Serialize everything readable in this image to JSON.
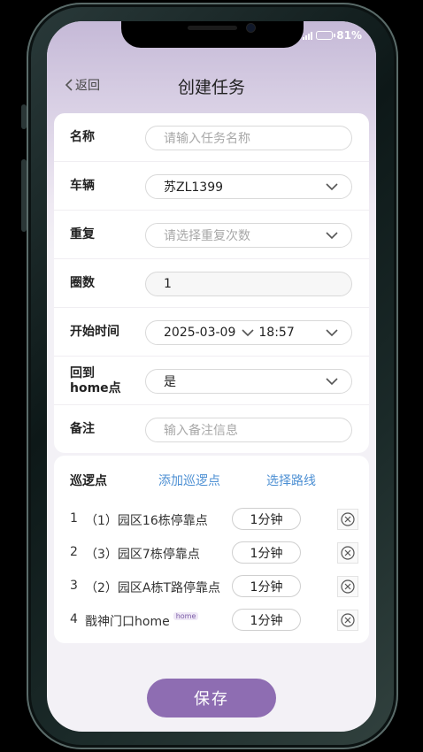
{
  "status_bar": {
    "battery": "81%"
  },
  "nav": {
    "back_label": "返回",
    "title": "创建任务"
  },
  "form": {
    "name": {
      "label": "名称",
      "placeholder": "请输入任务名称"
    },
    "vehicle": {
      "label": "车辆",
      "value": "苏ZL1399"
    },
    "repeat": {
      "label": "重复",
      "placeholder": "请选择重复次数"
    },
    "laps": {
      "label": "圈数",
      "value": "1"
    },
    "start_time": {
      "label": "开始时间",
      "date": "2025-03-09",
      "time": "18:57"
    },
    "return_home": {
      "label_line1": "回到",
      "label_line2": "home点",
      "value": "是"
    },
    "remark": {
      "label": "备注",
      "placeholder": "输入备注信息"
    }
  },
  "patrol": {
    "title": "巡逻点",
    "add_label": "添加巡逻点",
    "route_label": "选择路线",
    "items": [
      {
        "index": "1",
        "name": "（1）园区16栋停靠点",
        "duration": "1分钟"
      },
      {
        "index": "2",
        "name": "（3）园区7栋停靠点",
        "duration": "1分钟"
      },
      {
        "index": "3",
        "name": "（2）园区A栋T路停靠点",
        "duration": "1分钟"
      },
      {
        "index": "4",
        "name": "戬神门口home",
        "tag": "home",
        "duration": "1分钟"
      }
    ]
  },
  "actions": {
    "save_label": "保存"
  },
  "colors": {
    "accent": "#8e6db2",
    "link": "#4c8fd3",
    "header_gradient_top": "#c5b9d7"
  }
}
